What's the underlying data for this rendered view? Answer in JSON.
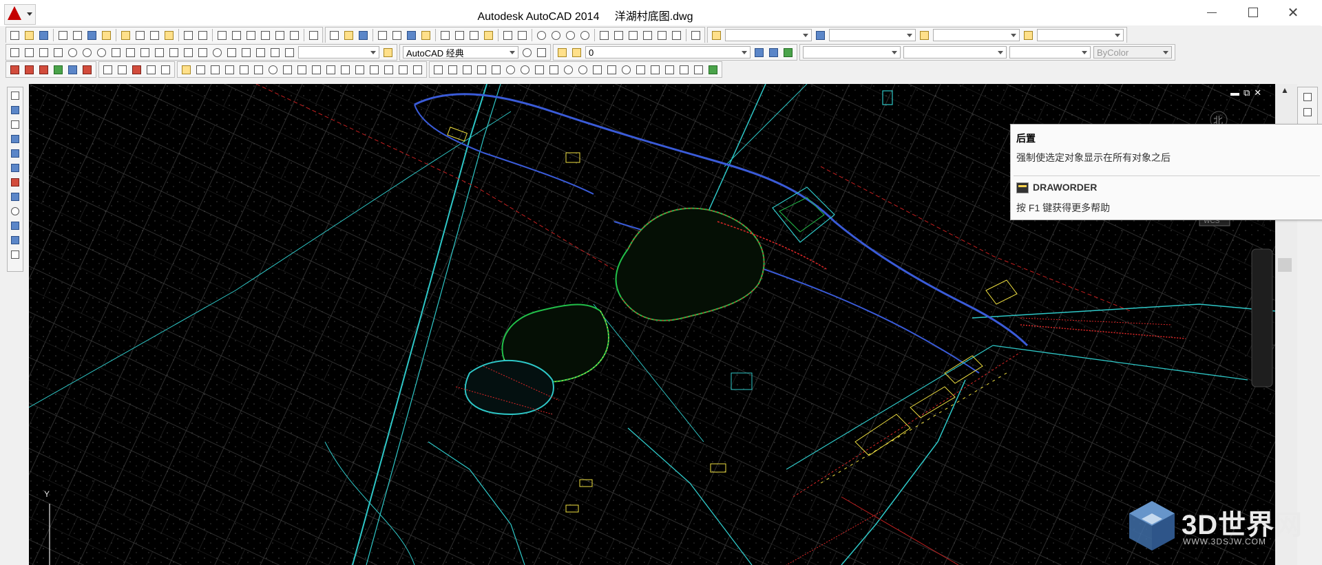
{
  "window": {
    "title": "Autodesk AutoCAD 2014     洋湖村底图.dwg",
    "minimize": "—",
    "maximize": "☐",
    "close": "✕"
  },
  "toolbar2": {
    "workspace": "AutoCAD 经典",
    "layer_value": "0",
    "color_value": "ByColor"
  },
  "viewport": {
    "controls": [
      "▬",
      "⧉",
      "✕"
    ],
    "compass_north": "北",
    "wcs": "WCS",
    "ucs_y": "Y"
  },
  "tooltip": {
    "title": "后置",
    "description": "强制使选定对象显示在所有对象之后",
    "command": "DRAWORDER",
    "help": "按 F1 键获得更多帮助"
  },
  "watermark": {
    "text": "3D世界网",
    "subtext": "WWW.3DSJW.COM"
  },
  "colors": {
    "canvas": "#000000",
    "road": "#2ec8c8",
    "blue_road": "#3a5bd8",
    "red": "#e02828",
    "green": "#22c04a",
    "yellow": "#f0e040",
    "pointer": "#e53a2b"
  }
}
